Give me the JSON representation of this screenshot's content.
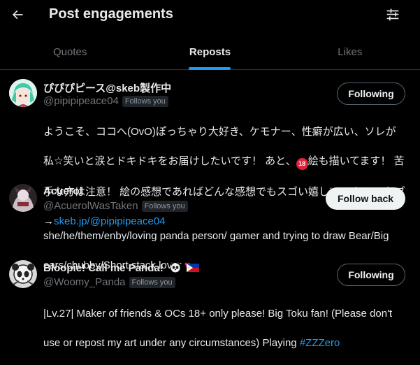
{
  "header": {
    "title": "Post engagements",
    "back_icon": "arrow-left-icon",
    "filter_icon": "sliders-icon"
  },
  "tabs": [
    {
      "label": "Quotes",
      "active": false
    },
    {
      "label": "Reposts",
      "active": true
    },
    {
      "label": "Likes",
      "active": false
    }
  ],
  "colors": {
    "accent": "#1d9bf0",
    "background": "#000000",
    "muted": "#71767b",
    "heart": "#e0245e"
  },
  "users": [
    {
      "name": "ぴぴぴピース@skeb製作中",
      "handle": "@pipipipeace04",
      "follows_you": "Follows you",
      "button": "Following",
      "bio_line1": "ようこそ、ココへ(OvO)ぽっちゃり大好き、ケモナー、性癖が広い、ソレが",
      "bio_line2": "私☆笑いと涙とドキドキをお届けしたいです！ あと、",
      "bio_age": "18",
      "bio_line2b": "絵も描いてます！ 苦",
      "bio_line3": "手な方は注意！ 絵の感想であればどんな感想でもスゴい嬉しいです！ スケブ",
      "bio_arrow": "→",
      "bio_link": "skeb.jp/@pipipipeace04"
    },
    {
      "name": "Acuerol",
      "handle": "@AcuerolWasTaken",
      "follows_you": "Follows you",
      "button": "Follow back",
      "bio_line1": "she/he/them/enby/loving panda person/ gamer and trying to draw Bear/Big",
      "bio_line2": "ears/chubby/Short stack lover",
      "bio_heart": "♥"
    },
    {
      "name": "Bloopie! Call me Panda!",
      "handle": "@Woomy_Panda",
      "follows_you": "Follows you",
      "button": "Following",
      "bio_line1": "|Lv.27| Maker of friends & OCs 18+ only please! Big Toku fan! (Please don't",
      "bio_line2": "use or repost my art under any circumstances) Playing",
      "bio_hashtag": "#ZZZero"
    }
  ]
}
